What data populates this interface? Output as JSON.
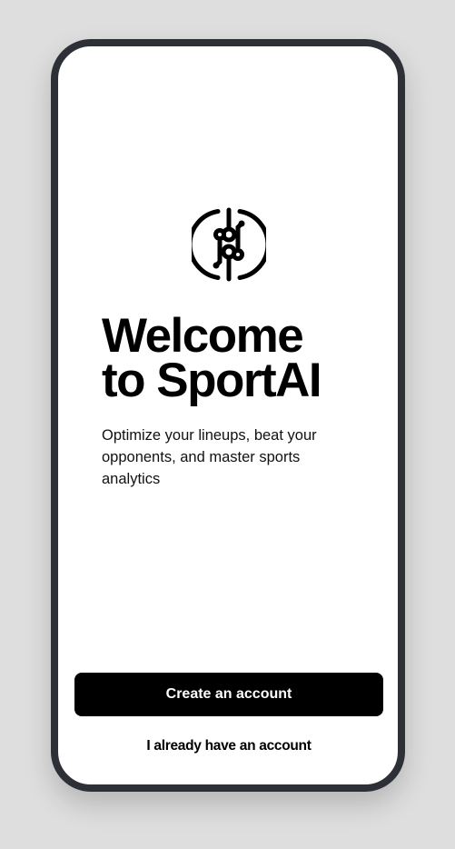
{
  "welcome": {
    "logo_icon": "sportai-circuit-logo-icon",
    "title": "Welcome\nto SportAI",
    "subtitle": "Optimize your lineups, beat your opponents, and master sports analytics"
  },
  "actions": {
    "create_account_label": "Create an account",
    "existing_account_label": "I already have an account"
  },
  "colors": {
    "frame": "#2d3037",
    "background": "#dedede",
    "primary_button": "#000000",
    "primary_button_text": "#ffffff",
    "text": "#000000"
  }
}
